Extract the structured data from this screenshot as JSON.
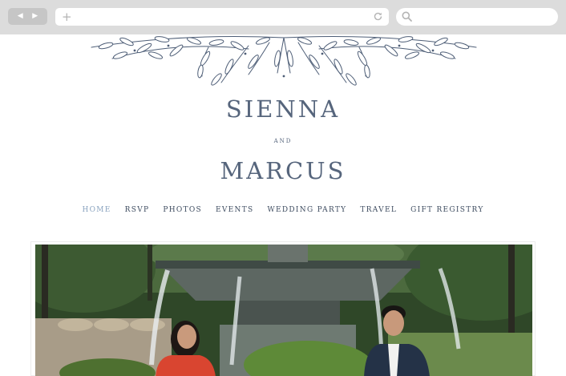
{
  "browser": {
    "back_icon": "back-arrow-icon",
    "forward_icon": "forward-arrow-icon",
    "new_tab_icon": "plus-icon",
    "reload_icon": "reload-icon",
    "search_icon": "search-icon",
    "back_glyph": "◀",
    "forward_glyph": "▶",
    "plus_glyph": "+"
  },
  "site": {
    "name_first": "SIENNA",
    "connector": "AND",
    "name_second": "MARCUS",
    "accent_color": "#56657c",
    "active_nav_color": "#8aa3bf"
  },
  "nav": {
    "items": [
      {
        "label": "HOME",
        "active": true
      },
      {
        "label": "RSVP"
      },
      {
        "label": "PHOTOS"
      },
      {
        "label": "EVENTS"
      },
      {
        "label": "WEDDING PARTY"
      },
      {
        "label": "TRAVEL"
      },
      {
        "label": "GIFT REGISTRY"
      }
    ]
  },
  "hero": {
    "image": "engagement-photo-by-fountain"
  }
}
